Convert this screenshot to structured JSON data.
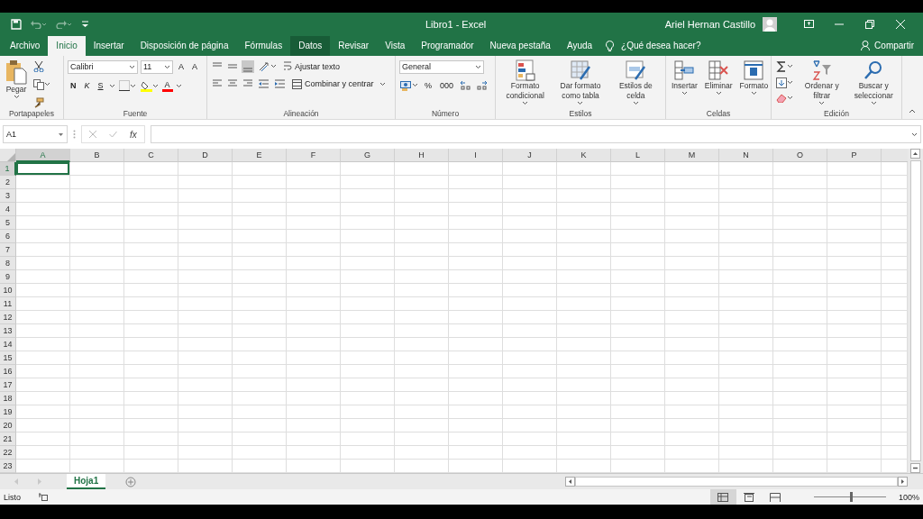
{
  "title_bar": {
    "title": "Libro1 - Excel",
    "user": "Ariel Hernan Castillo"
  },
  "ribbon_tabs": [
    {
      "label": "Archivo",
      "selected": false,
      "hovered": false
    },
    {
      "label": "Inicio",
      "selected": true,
      "hovered": false
    },
    {
      "label": "Insertar",
      "selected": false,
      "hovered": false
    },
    {
      "label": "Disposición de página",
      "selected": false,
      "hovered": false
    },
    {
      "label": "Fórmulas",
      "selected": false,
      "hovered": false
    },
    {
      "label": "Datos",
      "selected": false,
      "hovered": true
    },
    {
      "label": "Revisar",
      "selected": false,
      "hovered": false
    },
    {
      "label": "Vista",
      "selected": false,
      "hovered": false
    },
    {
      "label": "Programador",
      "selected": false,
      "hovered": false
    },
    {
      "label": "Nueva pestaña",
      "selected": false,
      "hovered": false
    },
    {
      "label": "Ayuda",
      "selected": false,
      "hovered": false
    }
  ],
  "tell_me": "¿Qué desea hacer?",
  "share": "Compartir",
  "ribbon_groups": [
    {
      "kind": "clipboard",
      "label": "Portapapeles",
      "paste": "Pegar"
    },
    {
      "kind": "font",
      "label": "Fuente",
      "font": "Calibri",
      "size": "11",
      "grow": "A",
      "shrink": "A",
      "styles": [
        "N",
        "K",
        "S"
      ],
      "color_letter": "A"
    },
    {
      "kind": "alignment",
      "label": "Alineación",
      "valign": [
        {
          "kind": "top",
          "selected": false
        },
        {
          "kind": "middle",
          "selected": false
        },
        {
          "kind": "bottom",
          "selected": true
        }
      ],
      "wrap": "Ajustar texto",
      "merge": "Combinar y centrar"
    },
    {
      "kind": "number",
      "label": "Número",
      "format": "General",
      "percent": "%",
      "thousands": "000"
    },
    {
      "kind": "styles",
      "label": "Estilos",
      "buttons": [
        "Formato condicional",
        "Dar formato como tabla",
        "Estilos de celda"
      ]
    },
    {
      "kind": "cells",
      "label": "Celdas",
      "buttons": [
        "Insertar",
        "Eliminar",
        "Formato"
      ]
    },
    {
      "kind": "editing",
      "label": "Edición",
      "buttons": [
        "Ordenar y filtrar",
        "Buscar y seleccionar"
      ]
    }
  ],
  "formula_bar": {
    "name_box": "A1",
    "fx": "fx"
  },
  "sheet": {
    "columns": [
      {
        "label": "A",
        "selected": true
      },
      {
        "label": "B",
        "selected": false
      },
      {
        "label": "C",
        "selected": false
      },
      {
        "label": "D",
        "selected": false
      },
      {
        "label": "E",
        "selected": false
      },
      {
        "label": "F",
        "selected": false
      },
      {
        "label": "G",
        "selected": false
      },
      {
        "label": "H",
        "selected": false
      },
      {
        "label": "I",
        "selected": false
      },
      {
        "label": "J",
        "selected": false
      },
      {
        "label": "K",
        "selected": false
      },
      {
        "label": "L",
        "selected": false
      },
      {
        "label": "M",
        "selected": false
      },
      {
        "label": "N",
        "selected": false
      },
      {
        "label": "O",
        "selected": false
      },
      {
        "label": "P",
        "selected": false
      }
    ],
    "rows": [
      {
        "label": "1",
        "selected": true
      },
      {
        "label": "2",
        "selected": false
      },
      {
        "label": "3",
        "selected": false
      },
      {
        "label": "4",
        "selected": false
      },
      {
        "label": "5",
        "selected": false
      },
      {
        "label": "6",
        "selected": false
      },
      {
        "label": "7",
        "selected": false
      },
      {
        "label": "8",
        "selected": false
      },
      {
        "label": "9",
        "selected": false
      },
      {
        "label": "10",
        "selected": false
      },
      {
        "label": "11",
        "selected": false
      },
      {
        "label": "12",
        "selected": false
      },
      {
        "label": "13",
        "selected": false
      },
      {
        "label": "14",
        "selected": false
      },
      {
        "label": "15",
        "selected": false
      },
      {
        "label": "16",
        "selected": false
      },
      {
        "label": "17",
        "selected": false
      },
      {
        "label": "18",
        "selected": false
      },
      {
        "label": "19",
        "selected": false
      },
      {
        "label": "20",
        "selected": false
      },
      {
        "label": "21",
        "selected": false
      },
      {
        "label": "22",
        "selected": false
      },
      {
        "label": "23",
        "selected": false
      }
    ]
  },
  "sheet_tabs": [
    {
      "label": "Hoja1",
      "selected": true
    }
  ],
  "status_bar": {
    "text": "Listo",
    "views": [
      {
        "kind": "normal",
        "selected": true
      },
      {
        "kind": "layout",
        "selected": false
      },
      {
        "kind": "break",
        "selected": false
      }
    ],
    "zoom": {
      "level": 0.5,
      "reading": "100%"
    }
  }
}
